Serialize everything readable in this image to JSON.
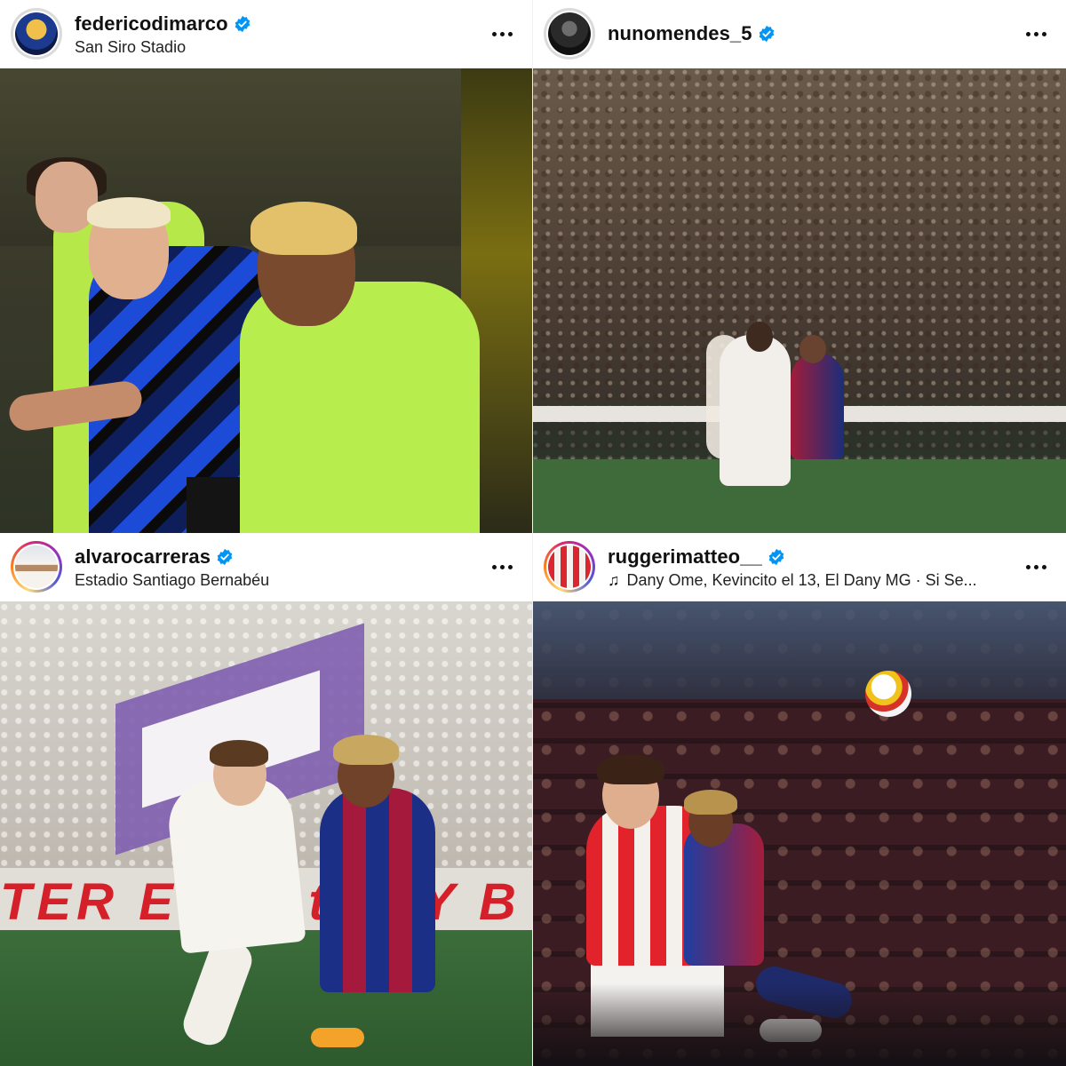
{
  "posts": [
    {
      "username": "federicodimarco",
      "subtitle": "San Siro Stadio",
      "verified": true,
      "has_story_ring": false,
      "subtitle_type": "location"
    },
    {
      "username": "nunomendes_5",
      "subtitle": "",
      "verified": true,
      "has_story_ring": false,
      "subtitle_type": "none"
    },
    {
      "username": "alvarocarreras",
      "subtitle": "Estadio Santiago Bernabéu",
      "verified": true,
      "has_story_ring": true,
      "subtitle_type": "location"
    },
    {
      "username": "ruggerimatteo__",
      "subtitle": "Dany Ome, Kevincito el 13, El Dany MG · Si Se...",
      "verified": true,
      "has_story_ring": true,
      "subtitle_type": "music"
    }
  ],
  "ad_board_text": "TER   Emirat   FLY B",
  "colors": {
    "verified_blue": "#0095f6",
    "text_primary": "#111111",
    "background": "#ffffff"
  },
  "icons": {
    "more": "more-options-icon",
    "verified": "verified-badge-icon",
    "music": "music-note-icon"
  }
}
